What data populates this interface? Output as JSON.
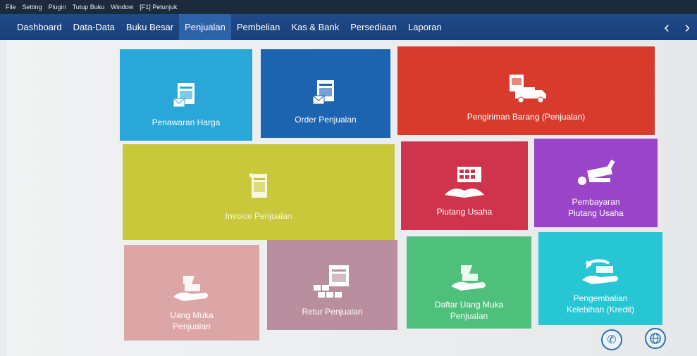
{
  "menubar": {
    "items": [
      "File",
      "Setting",
      "Plugin",
      "Tutup Buku",
      "Window",
      "[F1] Petunjuk"
    ]
  },
  "nav": {
    "tabs": [
      "Dashboard",
      "Data-Data",
      "Buku Besar",
      "Penjualan",
      "Pembelian",
      "Kas & Bank",
      "Persediaan",
      "Laporan"
    ],
    "active_tab": "Penjualan",
    "prev_icon": "chevron-left-icon",
    "next_icon": "chevron-right-icon"
  },
  "tiles": {
    "penawaran_harga": {
      "label": "Penawaran Harga",
      "color": "#2aa7d9",
      "icon": "document-envelope-icon"
    },
    "order_penjualan": {
      "label": "Order Penjualan",
      "color": "#1c63b0",
      "icon": "document-envelope-icon"
    },
    "pengiriman_barang": {
      "label": "Pengiriman Barang (Penjualan)",
      "color": "#d83a2c",
      "icon": "truck-icon"
    },
    "invoice_penjualan": {
      "label": "Invoice Penjualan",
      "color": "#c9c83a",
      "icon": "invoice-icon"
    },
    "piutang_usaha": {
      "label": "Piutang Usaha",
      "color": "#d0334c",
      "icon": "book-calendar-icon"
    },
    "pembayaran_piutang": {
      "label": "Pembayaran\nPiutang Usaha",
      "color": "#9a45c9",
      "icon": "payment-icon"
    },
    "uang_muka": {
      "label": "Uang Muka\nPenjualan",
      "color": "#dda6a6",
      "icon": "hand-money-icon"
    },
    "retur_penjualan": {
      "label": "Retur Penjualan",
      "color": "#b98e9e",
      "icon": "boxes-icon"
    },
    "daftar_uang_muka": {
      "label": "Daftar Uang Muka\nPenjualan",
      "color": "#4fbf7c",
      "icon": "hand-money-icon"
    },
    "pengembalian": {
      "label": "Pengembalian\nKelebihan (Kredit)",
      "color": "#27c6d4",
      "icon": "hand-refund-icon"
    }
  },
  "footer": {
    "phone_icon": "phone-icon",
    "globe_icon": "globe-icon"
  }
}
